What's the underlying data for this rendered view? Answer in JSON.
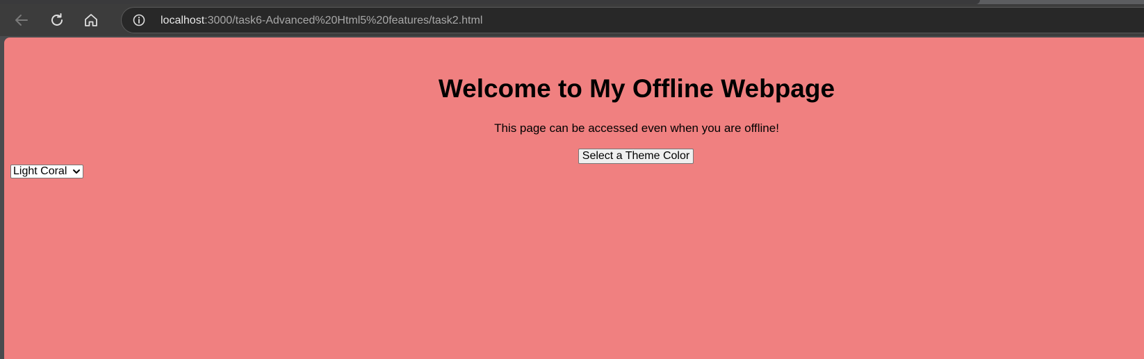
{
  "browser": {
    "url_host": "localhost",
    "url_path": ":3000/task6-Advanced%20Html5%20features/task2.html",
    "icons": [
      "back-arrow-icon",
      "reload-icon",
      "home-icon",
      "info-icon"
    ]
  },
  "page": {
    "background_color": "#f08080",
    "theme_select": {
      "selected_value": "Light Coral"
    },
    "heading": "Welcome to My Offline Webpage",
    "subtitle": "This page can be accessed even when you are offline!",
    "theme_button_label": "Select a Theme Color"
  }
}
